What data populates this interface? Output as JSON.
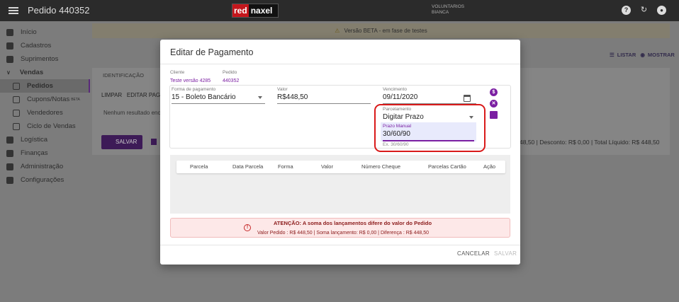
{
  "topbar": {
    "title": "Pedido 440352",
    "logo_red": "red",
    "logo_rest": "naxel",
    "user_line1": "VOLUNTARIOS",
    "user_line2": "BIANCA",
    "help_glyph": "?",
    "refresh_glyph": "↻",
    "account_glyph": "●"
  },
  "sidebar": {
    "items": [
      {
        "label": "Início",
        "icon": "home-icon"
      },
      {
        "label": "Cadastros",
        "icon": "folder-icon"
      },
      {
        "label": "Suprimentos",
        "icon": "box-icon"
      },
      {
        "label": "Vendas",
        "icon": "chevron-down-icon"
      },
      {
        "label": "Pedidos",
        "icon": "list-icon"
      },
      {
        "label": "Cupons/Notas",
        "sup": "BETA",
        "icon": "receipt-icon"
      },
      {
        "label": "Vendedores",
        "icon": "badge-icon"
      },
      {
        "label": "Ciclo de Vendas",
        "icon": "infinity-icon"
      },
      {
        "label": "Logística",
        "icon": "diamond-icon"
      },
      {
        "label": "Finanças",
        "icon": "dollar-icon"
      },
      {
        "label": "Administração",
        "icon": "shield-icon"
      },
      {
        "label": "Configurações",
        "icon": "gear-icon"
      }
    ]
  },
  "background": {
    "beta_banner": "Versão BETA - em fase de testes",
    "listar": "LISTAR",
    "mostrar": "MOSTRAR",
    "tab_identificacao": "IDENTIFICAÇÃO",
    "limpar": "LIMPAR",
    "editar_pagamento": "EDITAR PAGA",
    "no_result": "Nenhum resultado enco",
    "save_button": "SALVAR",
    "totals": "48,50 | Desconto: R$ 0,00 | Total Líquido: R$ 448,50"
  },
  "modal": {
    "title": "Editar de Pagamento",
    "cliente_label": "Cliente",
    "cliente_value": "Teste versão 4285",
    "pedido_label": "Pedido",
    "pedido_value": "440352",
    "forma_label": "Forma de pagamento",
    "forma_value": "15 - Boleto Bancário",
    "valor_label": "Valor",
    "valor_value": "R$448,50",
    "vencimento_label": "Vencimento",
    "vencimento_value": "09/11/2020",
    "parcelamento_label": "Parcelamento",
    "parcelamento_value": "Digitar Prazo",
    "prazo_label": "Prazo Manual",
    "prazo_value": "30/60/90",
    "prazo_hint": "Ex. 30/60/90",
    "table_headers": [
      "Parcela",
      "Data Parcela",
      "Forma",
      "Valor",
      "Número Cheque",
      "Parcelas Cartão",
      "Ação"
    ],
    "alert_title": "ATENÇÃO: A soma dos lançamentos difere do valor do Pedido",
    "alert_detail": "Valor Pedido : R$ 448,50 | Soma lançamento: R$ 0,00 | Diferença : R$ 448,50",
    "cancel_label": "CANCELAR",
    "save_label": "SALVAR",
    "dollar_glyph": "$",
    "close_glyph": "✕",
    "alert_glyph": "!"
  },
  "colors": {
    "accent": "#7b1fa2",
    "highlight": "#d91a1a",
    "alert_bg": "#fde8e8"
  }
}
